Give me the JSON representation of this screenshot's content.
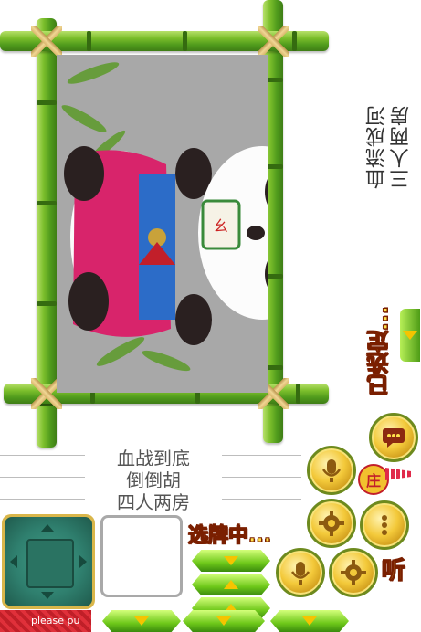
{
  "room_label_vertical": [
    "三人两房",
    "血流成河"
  ],
  "room_label_list": [
    "血战到底",
    "倒倒胡",
    "四人两房"
  ],
  "status_selected": "已选定...",
  "status_choosing": "选牌中...",
  "tile_text": "幺鸡",
  "button_ting_label": "听",
  "bottom_notice": "please pu",
  "flag_label": "庄",
  "colors": {
    "bamboo": "#6fb52a",
    "photo_bg": "#a8a8a8",
    "gold": "#ffe14a",
    "jade": "#2f7f6e"
  }
}
